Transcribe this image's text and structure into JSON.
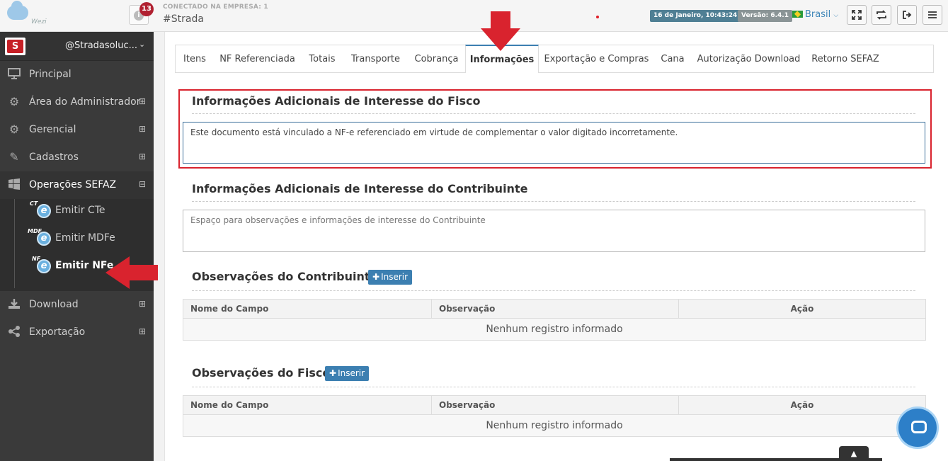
{
  "app": {
    "logo_text": "Wezi",
    "notifications_count": "13",
    "info_glyph": "i",
    "company_label": "CONECTADO NA EMPRESA: 1",
    "company_name": "#Strada",
    "datetime": "16 de Janeiro, 10:43:24",
    "version": "Versão: 6.4.1",
    "country": "Brasil",
    "toolbar_icons": [
      "fullscreen-icon",
      "refresh-icon",
      "logout-icon",
      "menu-icon"
    ]
  },
  "sidebar": {
    "account_name": "@Stradasoluc...",
    "items": [
      {
        "label": "Principal",
        "icon": "monitor-icon",
        "expand": ""
      },
      {
        "label": "Área do Administrador",
        "icon": "gears-icon",
        "expand": "⊞"
      },
      {
        "label": "Gerencial",
        "icon": "gears-icon",
        "expand": "⊞"
      },
      {
        "label": "Cadastros",
        "icon": "edit-icon",
        "expand": "⊞"
      },
      {
        "label": "Operações SEFAZ",
        "icon": "windows-icon",
        "expand": "⊟"
      },
      {
        "label": "Download",
        "icon": "download-icon",
        "expand": "⊞"
      },
      {
        "label": "Exportação",
        "icon": "share-icon",
        "expand": "⊞"
      }
    ],
    "subitems": [
      {
        "label": "Emitir CTe",
        "sup": "CT"
      },
      {
        "label": "Emitir MDFe",
        "sup": "MDF"
      },
      {
        "label": "Emitir NFe",
        "sup": "NF"
      }
    ]
  },
  "tabs": [
    "Itens",
    "NF Referenciada",
    "Totais",
    "Transporte",
    "Cobrança",
    "Informações",
    "Exportação e Compras",
    "Cana",
    "Autorização Download",
    "Retorno SEFAZ"
  ],
  "sections": {
    "fisco_title": "Informações Adicionais de Interesse do Fisco",
    "fisco_value": "Este documento está vinculado a NF-e referenciado em virtude de complementar o valor digitado incorretamente.",
    "contrib_title": "Informações Adicionais de Interesse do Contribuinte",
    "contrib_placeholder": "Espaço para observações e informações de interesse do Contribuinte",
    "obs_contrib_title": "Observações do Contribuinte",
    "obs_fisco_title": "Observações do Fisco",
    "insert_label": "Inserir",
    "columns": [
      "Nome do Campo",
      "Observação",
      "Ação"
    ],
    "empty_text": "Nenhum registro informado"
  },
  "colors": {
    "accent": "#3c7fb1",
    "highlight": "#d9232e",
    "sidebar_bg": "#3a3a3a"
  }
}
